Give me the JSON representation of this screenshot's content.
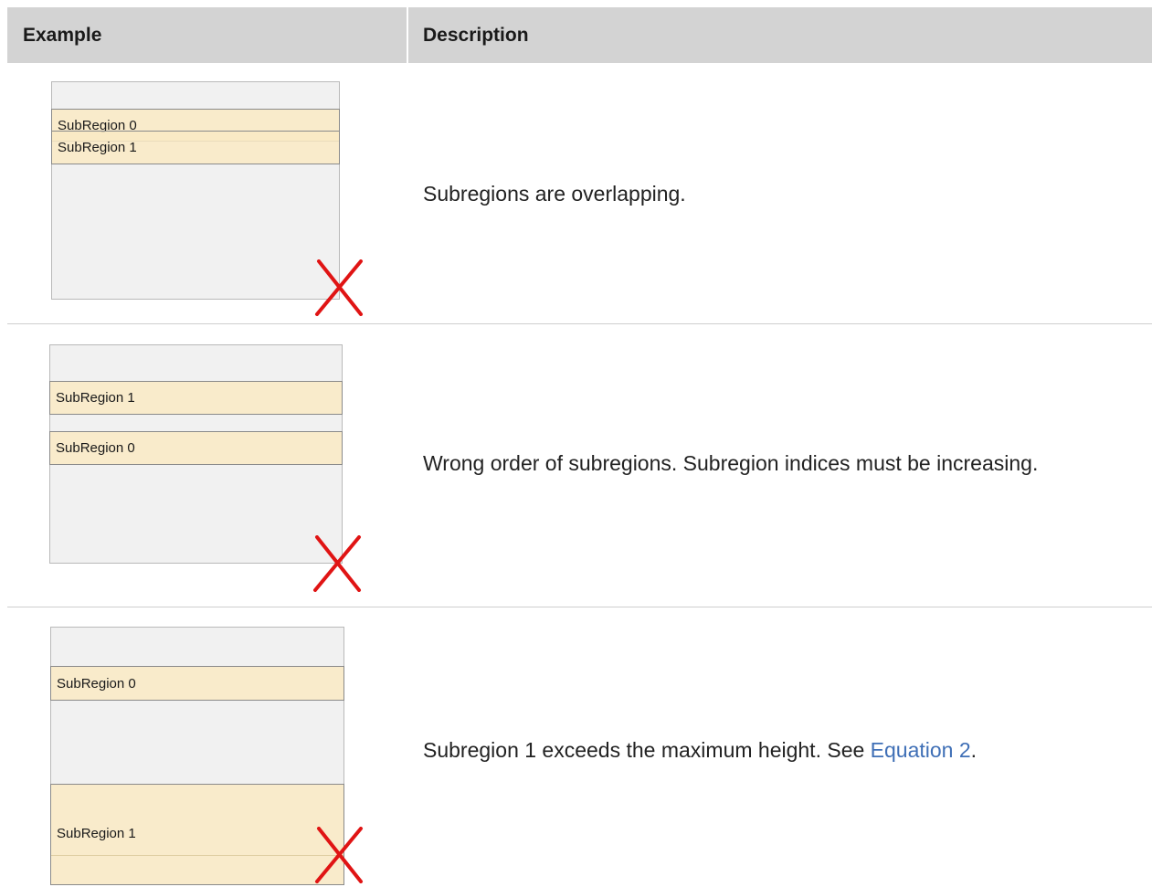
{
  "header": {
    "example_label": "Example",
    "description_label": "Description"
  },
  "rows": [
    {
      "subregions": [
        "SubRegion 0",
        "SubRegion 1"
      ],
      "description": "Subregions are overlapping."
    },
    {
      "subregions": [
        "SubRegion 1",
        "SubRegion 0"
      ],
      "description": "Wrong order of subregions. Subregion indices must be increasing."
    },
    {
      "subregions": [
        "SubRegion 0",
        "SubRegion 1"
      ],
      "description_prefix": "Subregion 1 exceeds the maximum height. See ",
      "description_link": "Equation 2",
      "description_suffix": "."
    }
  ],
  "icons": {
    "error_mark": "cross-mark-icon"
  },
  "colors": {
    "header_bg": "#d3d3d3",
    "subregion_fill": "#faeac4",
    "container_fill": "#f1f1f1",
    "error_red": "#e01414",
    "link": "#3f6fb6"
  }
}
